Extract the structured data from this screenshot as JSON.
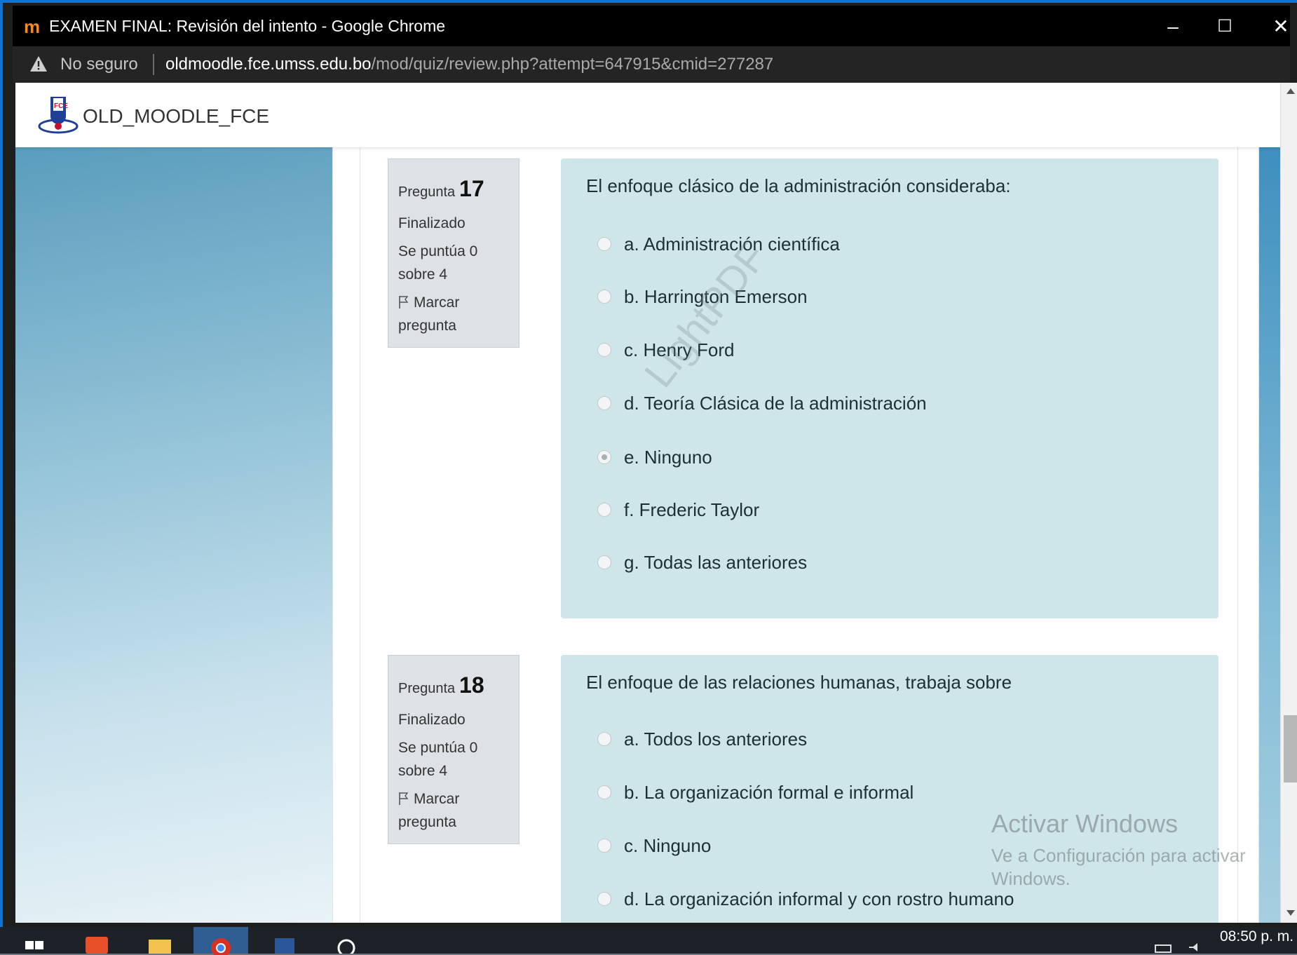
{
  "window": {
    "title": "EXAMEN FINAL: Revisión del intento - Google Chrome",
    "favicon": "m",
    "controls": {
      "minimize": "–",
      "maximize": "☐",
      "close": "✕"
    }
  },
  "address_bar": {
    "security_label": "No seguro",
    "url_host": "oldmoodle.fce.umss.edu.bo",
    "url_path": "/mod/quiz/review.php?attempt=647915&cmid=277287"
  },
  "site": {
    "name": "OLD_MOODLE_FCE"
  },
  "questions": [
    {
      "label": "Pregunta",
      "number": "17",
      "state": "Finalizado",
      "grade_line1": "Se puntúa 0",
      "grade_line2": "sobre 4",
      "flag_line1": "Marcar",
      "flag_line2": "pregunta",
      "text": "El enfoque clásico de la administración consideraba:",
      "answers": [
        {
          "label": "a. Administración científica",
          "selected": false
        },
        {
          "label": "b. Harrington Emerson",
          "selected": false
        },
        {
          "label": "c. Henry Ford",
          "selected": false
        },
        {
          "label": "d. Teoría Clásica de la administración",
          "selected": false
        },
        {
          "label": "e. Ninguno",
          "selected": true
        },
        {
          "label": "f. Frederic Taylor",
          "selected": false
        },
        {
          "label": "g. Todas las anteriores",
          "selected": false
        }
      ]
    },
    {
      "label": "Pregunta",
      "number": "18",
      "state": "Finalizado",
      "grade_line1": "Se puntúa 0",
      "grade_line2": "sobre 4",
      "flag_line1": "Marcar",
      "flag_line2": "pregunta",
      "text": "El enfoque de las relaciones humanas, trabaja sobre",
      "answers": [
        {
          "label": "a. Todos los anteriores",
          "selected": false
        },
        {
          "label": "b. La organización formal e informal",
          "selected": false
        },
        {
          "label": "c. Ninguno",
          "selected": false
        },
        {
          "label": "d. La organización informal y con rostro humano",
          "selected": false
        }
      ]
    }
  ],
  "watermark": "LightPDF",
  "windows_notice": {
    "title": "Activar Windows",
    "line1": "Ve a Configuración para activar",
    "line2": "Windows."
  },
  "taskbar": {
    "clock": "08:50 p. m."
  },
  "colors": {
    "question_bg": "#cee6ea",
    "info_bg": "#dee2e6",
    "titlebar": "#000000"
  }
}
